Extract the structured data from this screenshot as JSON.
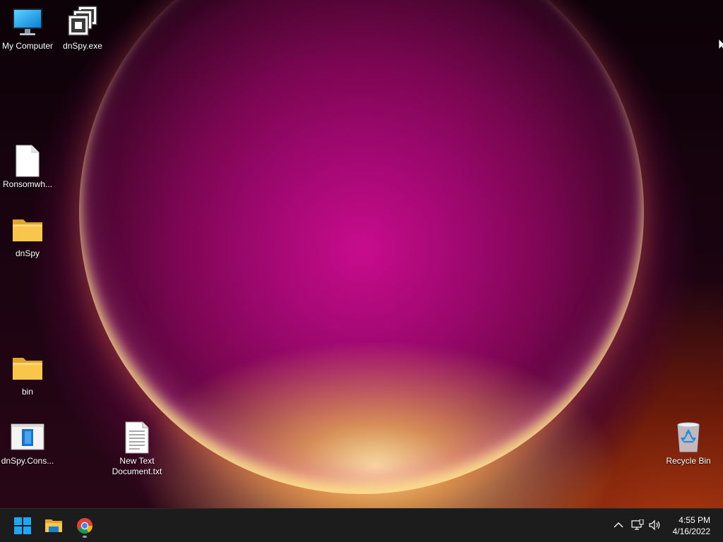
{
  "desktop": {
    "icons": [
      {
        "label": "My Computer",
        "icon": "monitor-icon"
      },
      {
        "label": "dnSpy.exe",
        "icon": "app-window-icon"
      },
      {
        "label": "Ronsomwh...",
        "icon": "blank-file-icon"
      },
      {
        "label": "dnSpy",
        "icon": "folder-icon"
      },
      {
        "label": "bin",
        "icon": "folder-icon"
      },
      {
        "label": "dnSpy.Cons...",
        "icon": "console-app-icon"
      },
      {
        "label": "New Text Document.txt",
        "icon": "text-file-icon"
      },
      {
        "label": "Recycle Bin",
        "icon": "recycle-bin-icon"
      }
    ]
  },
  "taskbar": {
    "pinned": [
      {
        "name": "Start",
        "icon": "windows-logo-icon"
      },
      {
        "name": "File Explorer",
        "icon": "file-explorer-icon"
      },
      {
        "name": "Google Chrome",
        "icon": "chrome-icon",
        "running": true
      }
    ],
    "tray": {
      "icons": [
        "chevron-up-icon",
        "network-icon",
        "volume-icon"
      ],
      "time": "4:55 PM",
      "date": "4/16/2022"
    }
  },
  "colors": {
    "taskbar_bg": "#1c1c1c",
    "folder_yellow": "#f8c64a",
    "windows_blue": "#1ea7f5"
  }
}
